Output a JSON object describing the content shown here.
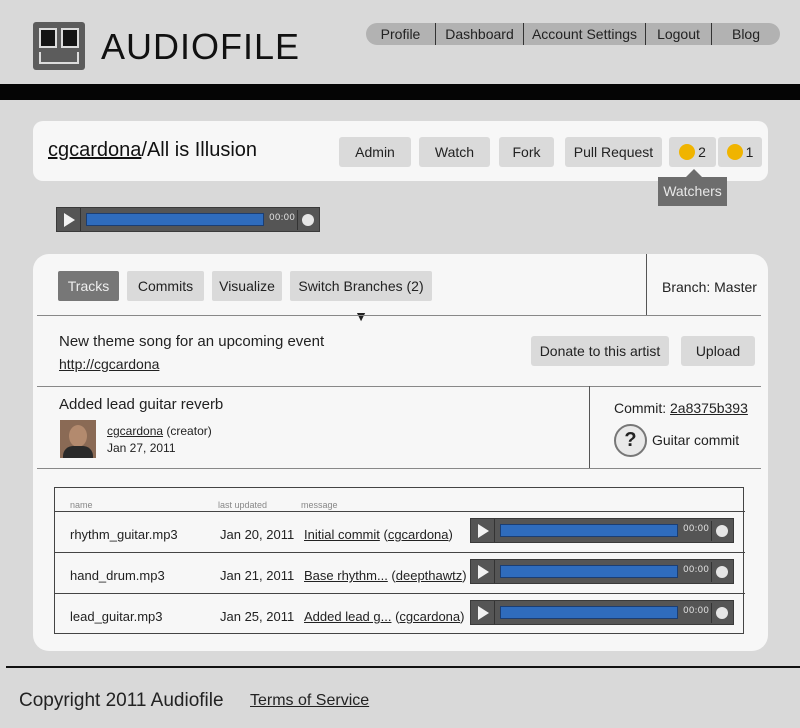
{
  "header": {
    "brand": "AUDIOFILE",
    "nav": [
      "Profile",
      "Dashboard",
      "Account Settings",
      "Logout",
      "Blog"
    ]
  },
  "repo": {
    "owner": "cgcardona",
    "separator": "/",
    "name": "All is Illusion",
    "actions": {
      "admin": "Admin",
      "watch": "Watch",
      "fork": "Fork",
      "pull_request": "Pull Request",
      "watchers_count": "2",
      "forks_count": "1"
    },
    "tooltip": "Watchers",
    "player_time": "00:00"
  },
  "tabs": {
    "tracks": "Tracks",
    "commits": "Commits",
    "visualize": "Visualize",
    "switch_branches": "Switch Branches (2) ▼",
    "branch": "Branch: Master"
  },
  "description": {
    "text": "New theme song for an upcoming event",
    "url": "http://cgcardona",
    "donate": "Donate to this artist",
    "upload": "Upload"
  },
  "commit": {
    "message": "Added lead guitar reverb",
    "author": "cgcardona",
    "role": "(creator)",
    "date": "Jan 27, 2011",
    "commit_label": "Commit:",
    "hash": "2a8375b393",
    "help_glyph": "?",
    "commit_name": "Guitar commit"
  },
  "table": {
    "headers": [
      "name",
      "last updated",
      "message"
    ],
    "rows": [
      {
        "name": "rhythm_guitar.mp3",
        "date": "Jan 20, 2011",
        "message": "Initial commit",
        "user": "cgcardona",
        "time": "00:00"
      },
      {
        "name": "hand_drum.mp3",
        "date": "Jan 21, 2011",
        "message": "Base rhythm...",
        "user": "deepthawtz",
        "time": "00:00"
      },
      {
        "name": "lead_guitar.mp3",
        "date": "Jan 25, 2011",
        "message": "Added lead g...",
        "user": "cgcardona",
        "time": "00:00"
      }
    ]
  },
  "footer": {
    "copyright": "Copyright 2011 Audiofile",
    "terms": "Terms of Service"
  },
  "colors": {
    "background": "#d9d9d9",
    "card": "#f7f7f7",
    "player_blue": "#2f6cbd",
    "badge_yellow": "#f0b400"
  }
}
